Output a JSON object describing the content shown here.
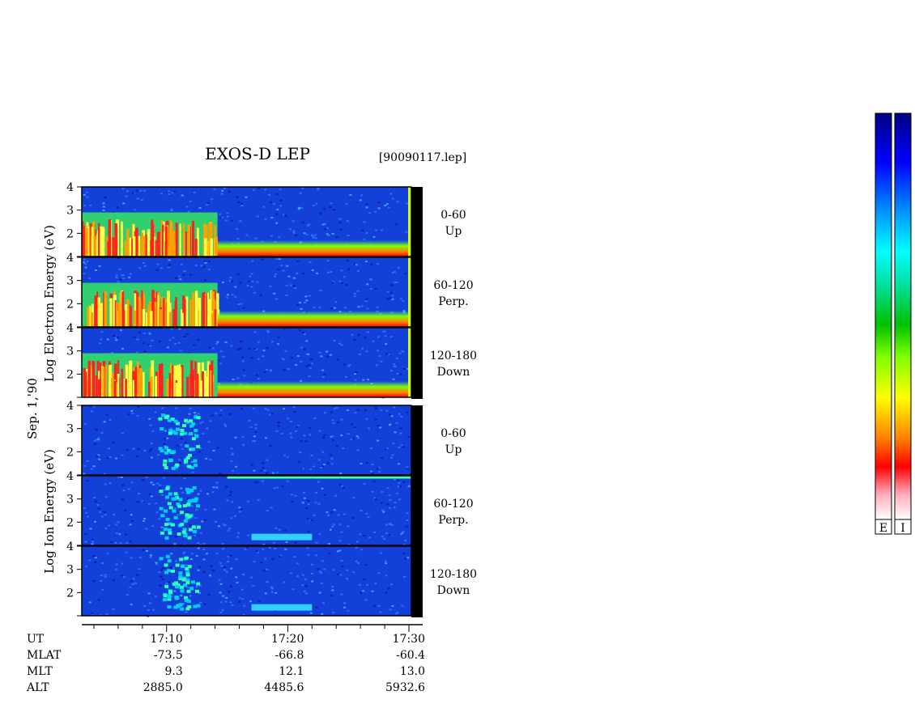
{
  "title": "EXOS-D LEP",
  "file": "[90090117.lep]",
  "date": "Sep. 1,'90",
  "electron_ylabel": "Log  Electron  Energy (eV)",
  "ion_ylabel": "Log   Ion  Energy (eV)",
  "footer": {
    "rows": [
      {
        "label": "UT",
        "values": [
          "17:10",
          "17:20",
          "17:30"
        ]
      },
      {
        "label": "MLAT",
        "values": [
          "-73.5",
          "-66.8",
          "-60.4"
        ]
      },
      {
        "label": "MLT",
        "values": [
          "9.3",
          "12.1",
          "13.0"
        ]
      },
      {
        "label": "ALT",
        "values": [
          "2885.0",
          "4485.6",
          "5932.6"
        ]
      }
    ]
  },
  "colorbars": [
    {
      "label": "E"
    },
    {
      "label": "I"
    }
  ],
  "colorbar_colors": [
    "#ffffff",
    "#ffb0b0",
    "#ff0000",
    "#ff8000",
    "#ffff00",
    "#80ff00",
    "#00c000",
    "#00ffff",
    "#0080ff",
    "#0000ff",
    "#000090"
  ],
  "chart_data": {
    "type": "heatmap",
    "x_axis": {
      "ticks": [
        "17:10",
        "17:20",
        "17:30"
      ],
      "range": [
        "17:03",
        "17:30"
      ]
    },
    "y_axis": {
      "ticks": [
        "2",
        "3",
        "4"
      ],
      "unit": "Log Energy (eV)",
      "range": [
        1,
        4
      ]
    },
    "panels": [
      {
        "species": "Electron",
        "angle": "0-60",
        "direction": "Up",
        "y_ticks": [
          "2",
          "3",
          "4"
        ]
      },
      {
        "species": "Electron",
        "angle": "60-120",
        "direction": "Perp.",
        "y_ticks": [
          "2",
          "3",
          "4"
        ]
      },
      {
        "species": "Electron",
        "angle": "120-180",
        "direction": "Down",
        "y_ticks": [
          "2",
          "3",
          "4"
        ]
      },
      {
        "species": "Ion",
        "angle": "0-60",
        "direction": "Up",
        "y_ticks": [
          "2",
          "3",
          "4"
        ]
      },
      {
        "species": "Ion",
        "angle": "60-120",
        "direction": "Perp.",
        "y_ticks": [
          "2",
          "3",
          "4"
        ]
      },
      {
        "species": "Ion",
        "angle": "120-180",
        "direction": "Down",
        "y_ticks": [
          "2",
          "3",
          "4"
        ]
      }
    ]
  }
}
